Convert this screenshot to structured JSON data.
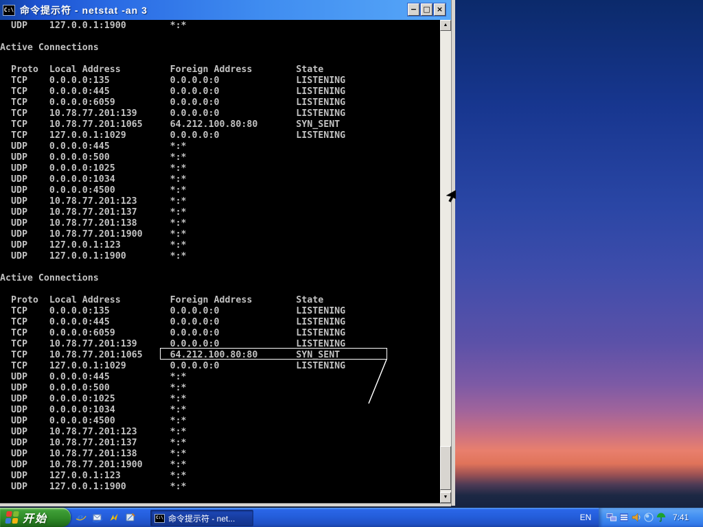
{
  "window": {
    "title": "命令提示符 - netstat -an 3",
    "icon_label": "C:\\",
    "controls": {
      "minimize": "−",
      "maximize": "□",
      "close": "×"
    }
  },
  "console": {
    "section_heading": "Active Connections",
    "columns": [
      "Proto",
      "Local Address",
      "Foreign Address",
      "State"
    ],
    "top_partial_row": [
      "UDP",
      "127.0.0.1:1900",
      "*:*",
      ""
    ],
    "repeat_blocks": 2,
    "rows": [
      [
        "TCP",
        "0.0.0.0:135",
        "0.0.0.0:0",
        "LISTENING"
      ],
      [
        "TCP",
        "0.0.0.0:445",
        "0.0.0.0:0",
        "LISTENING"
      ],
      [
        "TCP",
        "0.0.0.0:6059",
        "0.0.0.0:0",
        "LISTENING"
      ],
      [
        "TCP",
        "10.78.77.201:139",
        "0.0.0.0:0",
        "LISTENING"
      ],
      [
        "TCP",
        "10.78.77.201:1065",
        "64.212.100.80:80",
        "SYN_SENT"
      ],
      [
        "TCP",
        "127.0.0.1:1029",
        "0.0.0.0:0",
        "LISTENING"
      ],
      [
        "UDP",
        "0.0.0.0:445",
        "*:*",
        ""
      ],
      [
        "UDP",
        "0.0.0.0:500",
        "*:*",
        ""
      ],
      [
        "UDP",
        "0.0.0.0:1025",
        "*:*",
        ""
      ],
      [
        "UDP",
        "0.0.0.0:1034",
        "*:*",
        ""
      ],
      [
        "UDP",
        "0.0.0.0:4500",
        "*:*",
        ""
      ],
      [
        "UDP",
        "10.78.77.201:123",
        "*:*",
        ""
      ],
      [
        "UDP",
        "10.78.77.201:137",
        "*:*",
        ""
      ],
      [
        "UDP",
        "10.78.77.201:138",
        "*:*",
        ""
      ],
      [
        "UDP",
        "10.78.77.201:1900",
        "*:*",
        ""
      ],
      [
        "UDP",
        "127.0.0.1:123",
        "*:*",
        ""
      ],
      [
        "UDP",
        "127.0.0.1:1900",
        "*:*",
        ""
      ]
    ],
    "annotation": {
      "boxed_foreign_address": "64.212.100.80:80",
      "boxed_state": "SYN_SENT"
    }
  },
  "scrollbar": {
    "up_arrow": "▲",
    "down_arrow": "▼"
  },
  "taskbar": {
    "start_label": "开始",
    "task_button_label": "命令提示符 - net...",
    "task_button_icon_label": "C:\\",
    "language_indicator": "EN",
    "clock": "7:41",
    "quick_launch": [
      {
        "icon": "ie-icon"
      },
      {
        "icon": "outlook-express-icon"
      },
      {
        "icon": "messenger-icon"
      },
      {
        "icon": "show-desktop-icon"
      }
    ],
    "tray_icons": [
      {
        "icon": "network-icon"
      },
      {
        "icon": "ime-icon"
      },
      {
        "icon": "volume-icon"
      },
      {
        "icon": "internet-connection-icon"
      },
      {
        "icon": "antivirus-umbrella-icon"
      }
    ]
  },
  "colors": {
    "console_text": "#c2c2c2",
    "console_background": "#000000",
    "titlebar_blue": "#2a6be4",
    "taskbar_blue": "#245edb",
    "start_green": "#2f8a28",
    "annotation_white": "#ffffff"
  }
}
